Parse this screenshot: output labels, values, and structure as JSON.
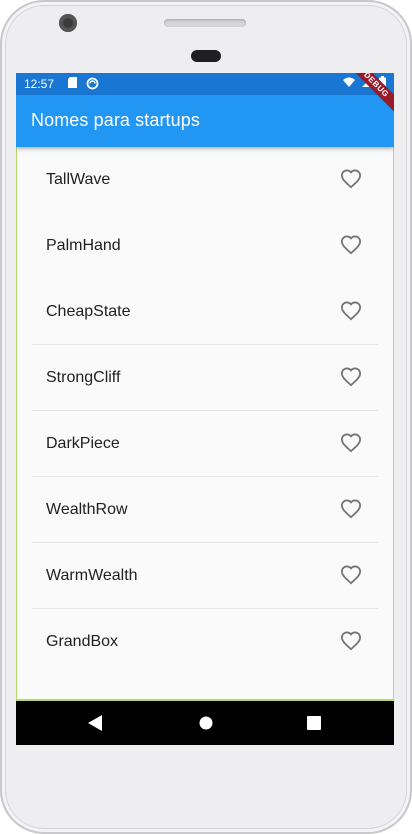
{
  "status_bar": {
    "time": "12:57",
    "icons": [
      "sd-card-icon",
      "sync-icon",
      "wifi-icon",
      "signal-icon",
      "battery-icon"
    ]
  },
  "app_bar": {
    "title": "Nomes para startups",
    "debug_banner": "DEBUG"
  },
  "list": {
    "items": [
      {
        "label": "TallWave",
        "favorite": false
      },
      {
        "label": "PalmHand",
        "favorite": false
      },
      {
        "label": "CheapState",
        "favorite": false
      },
      {
        "label": "StrongCliff",
        "favorite": false
      },
      {
        "label": "DarkPiece",
        "favorite": false
      },
      {
        "label": "WealthRow",
        "favorite": false
      },
      {
        "label": "WarmWealth",
        "favorite": false
      },
      {
        "label": "GrandBox",
        "favorite": false
      }
    ],
    "heart_icon": "heart-outline-icon"
  },
  "nav_bar": {
    "buttons": [
      "back-icon",
      "home-icon",
      "recents-icon"
    ]
  },
  "colors": {
    "status_bar": "#1976d2",
    "app_bar": "#2196f3",
    "heart_outline": "#757575",
    "text": "#212121",
    "debug_ribbon": "#9a1b27"
  }
}
